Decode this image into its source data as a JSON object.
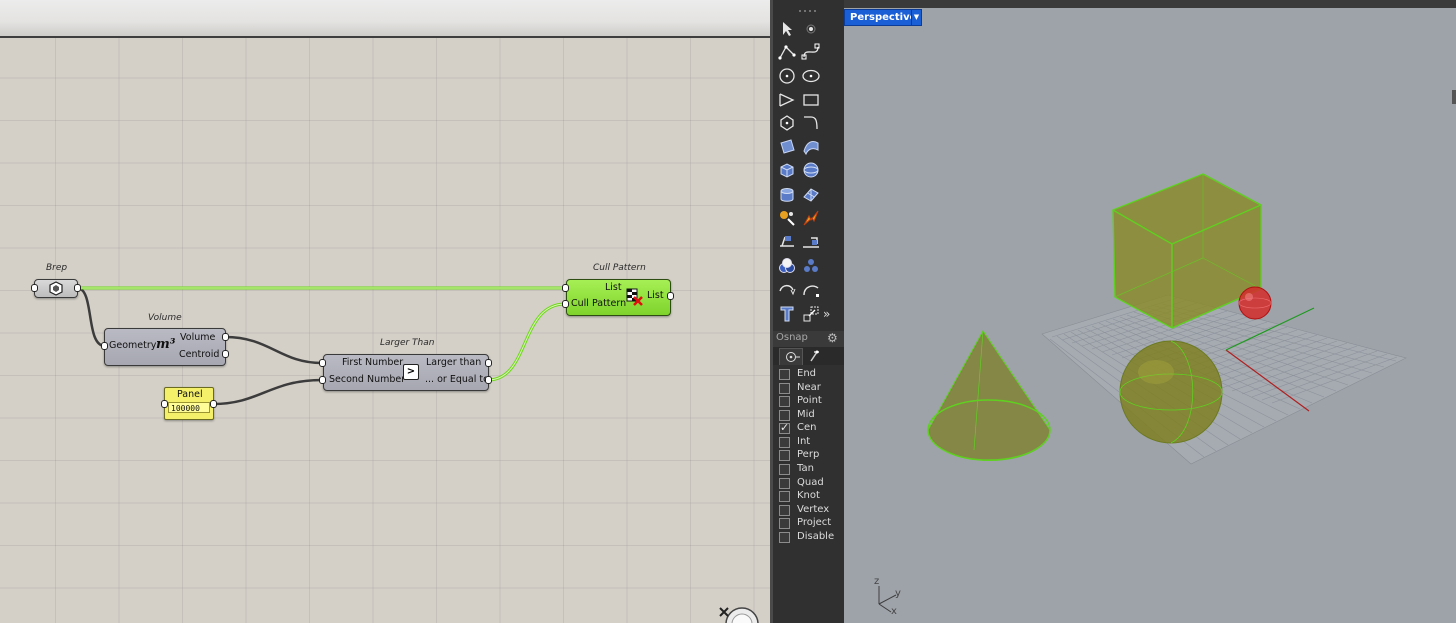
{
  "grasshopper": {
    "brep": {
      "title": "Brep"
    },
    "volume": {
      "title": "Volume",
      "input_geometry": "Geometry",
      "icon_text": "m³",
      "output_volume": "Volume",
      "output_centroid": "Centroid"
    },
    "larger_than": {
      "title": "Larger Than",
      "input_first": "First Number",
      "input_second": "Second Number",
      "operator": ">",
      "output_larger": "Larger than",
      "output_equal": "... or Equal to"
    },
    "panel": {
      "title": "Panel",
      "value": "100000"
    },
    "cull_pattern": {
      "title": "Cull Pattern",
      "input_list": "List",
      "input_pattern": "Cull Pattern",
      "output_list": "List"
    }
  },
  "toolbar": {
    "osnap_title": "Osnap",
    "osnap_items": [
      {
        "label": "End",
        "checked": false
      },
      {
        "label": "Near",
        "checked": false
      },
      {
        "label": "Point",
        "checked": false
      },
      {
        "label": "Mid",
        "checked": false
      },
      {
        "label": "Cen",
        "checked": true
      },
      {
        "label": "Int",
        "checked": false
      },
      {
        "label": "Perp",
        "checked": false
      },
      {
        "label": "Tan",
        "checked": false
      },
      {
        "label": "Quad",
        "checked": false
      },
      {
        "label": "Knot",
        "checked": false
      },
      {
        "label": "Vertex",
        "checked": false
      },
      {
        "label": "Project",
        "checked": false
      },
      {
        "label": "Disable",
        "checked": false
      }
    ],
    "more_glyph": "»"
  },
  "viewport": {
    "tab_label": "Perspective",
    "axis_labels": {
      "z": "z",
      "y": "y",
      "x": "x"
    }
  },
  "colors": {
    "selected_green": "#6fd61c",
    "object_fill": "#8a8a2a",
    "point_red": "#d42a2a",
    "wire": "#3c3c3c",
    "viewport_tab": "#1a5fd6"
  }
}
